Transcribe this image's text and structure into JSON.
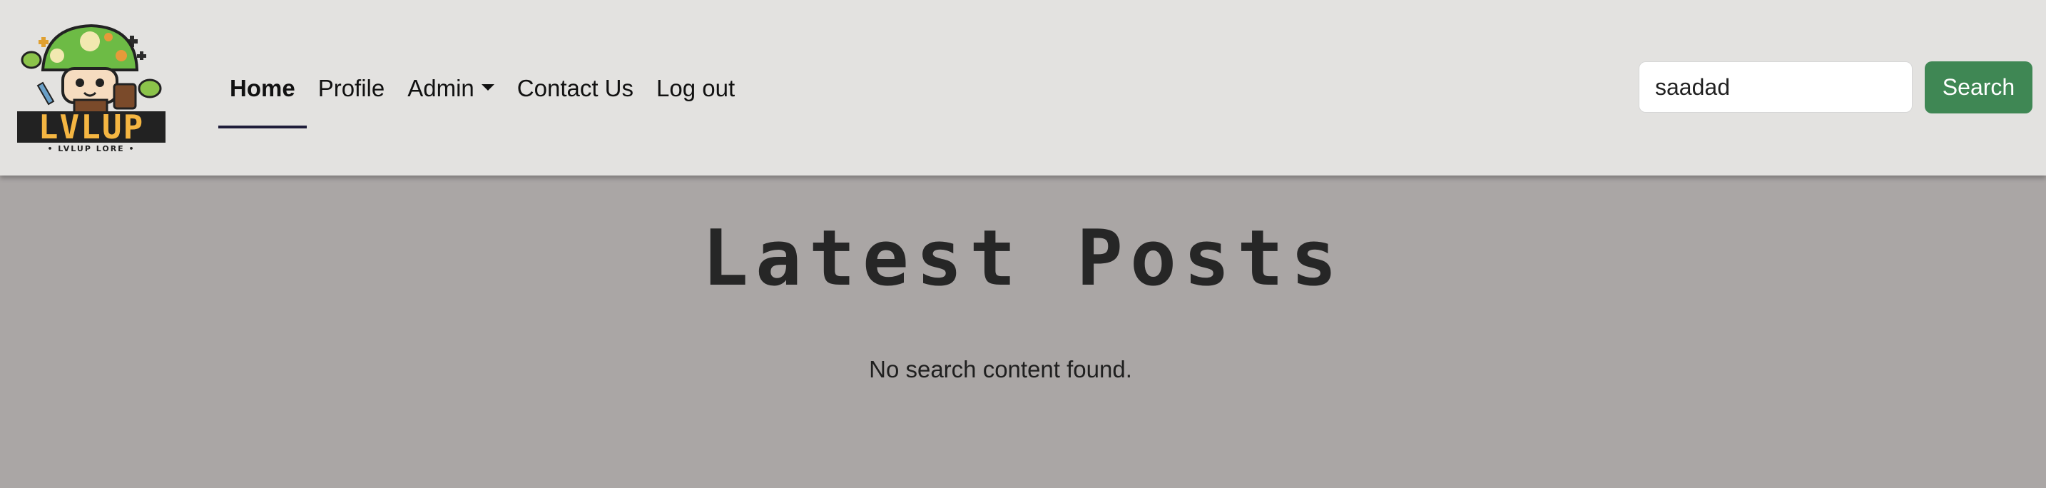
{
  "brand": {
    "logo_text": "LVLUP",
    "logo_tagline": "• LVLUP LORE •"
  },
  "nav": {
    "items": [
      {
        "label": "Home",
        "active": true
      },
      {
        "label": "Profile"
      },
      {
        "label": "Admin",
        "has_dropdown": true
      },
      {
        "label": "Contact Us"
      },
      {
        "label": "Log out"
      }
    ]
  },
  "search": {
    "value": "saadad",
    "button_label": "Search"
  },
  "main": {
    "title": "Latest Posts",
    "empty_message": "No search content found."
  },
  "colors": {
    "navbar_bg": "#e3e2e0",
    "page_bg": "#aaa6a5",
    "search_button": "#3f8754",
    "active_underline": "#1f1d3a"
  }
}
